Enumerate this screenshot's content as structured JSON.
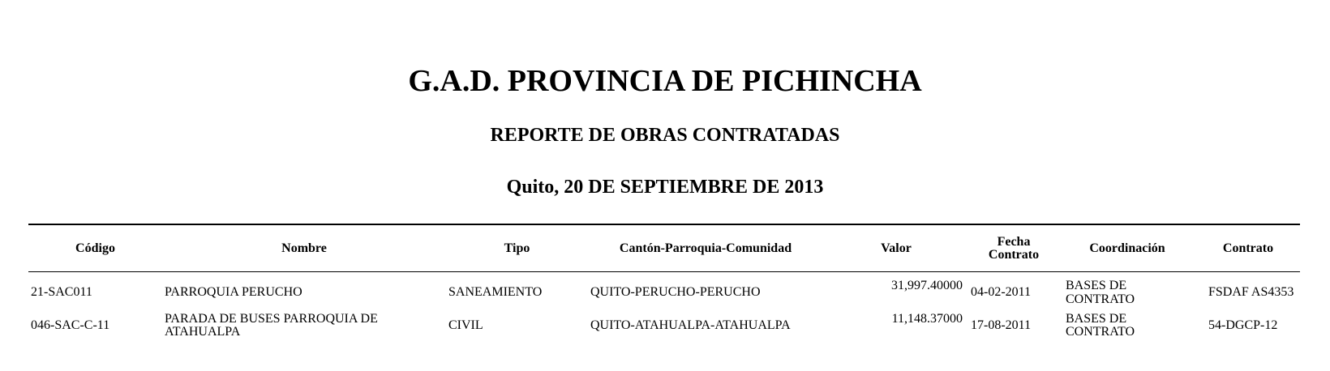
{
  "report": {
    "org_title": "G.A.D. PROVINCIA DE PICHINCHA",
    "report_title": "REPORTE DE OBRAS CONTRATADAS",
    "place_date": "Quito, 20 DE SEPTIEMBRE DE 2013"
  },
  "table": {
    "headers": {
      "codigo": "Código",
      "nombre": "Nombre",
      "tipo": "Tipo",
      "canton": "Cantón-Parroquia-Comunidad",
      "valor": "Valor",
      "fecha_line1": "Fecha",
      "fecha_line2": "Contrato",
      "coordinacion": "Coordinación",
      "contrato": "Contrato"
    },
    "rows": [
      {
        "codigo": "21-SAC011",
        "nombre_line1": "PARROQUIA PERUCHO",
        "nombre_line2": "",
        "tipo": "SANEAMIENTO",
        "canton": "QUITO-PERUCHO-PERUCHO",
        "valor": "31,997.40000",
        "fecha": "04-02-2011",
        "coord_line1": "BASES DE",
        "coord_line2": "CONTRATO",
        "contrato": "FSDAF AS4353"
      },
      {
        "codigo": "046-SAC-C-11",
        "nombre_line1": "PARADA DE BUSES PARROQUIA DE",
        "nombre_line2": "ATAHUALPA",
        "tipo": "CIVIL",
        "canton": "QUITO-ATAHUALPA-ATAHUALPA",
        "valor": "11,148.37000",
        "fecha": "17-08-2011",
        "coord_line1": "BASES DE",
        "coord_line2": "CONTRATO",
        "contrato": "54-DGCP-12"
      }
    ]
  }
}
